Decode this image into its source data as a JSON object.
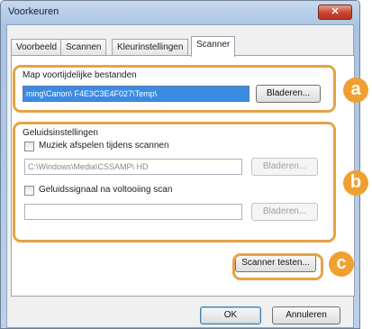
{
  "window": {
    "title": "Voorkeuren",
    "close_label": "✕"
  },
  "tabs": [
    {
      "label": "Voorbeeld"
    },
    {
      "label": "Scannen"
    },
    {
      "label": "Kleurinstellingen"
    },
    {
      "label": "Scanner"
    }
  ],
  "temp_folder": {
    "label": "Map voortijdelijke bestanden",
    "path": "ming\\Canon\\                F4E3C3E4F027\\Temp\\",
    "browse_label": "Bladeren..."
  },
  "sound": {
    "label": "Geluidsinstellingen",
    "music_checkbox_label": "Muziek afspelen tijdens scannen",
    "music_checked": false,
    "music_path": "C:\\Windows\\Media\\CSSAMP\\ HD",
    "music_browse_label": "Bladeren...",
    "complete_checkbox_label": "Geluidssignaal na voltooiing scan",
    "complete_checked": false,
    "complete_path": "",
    "complete_browse_label": "Bladeren..."
  },
  "test_button_label": "Scanner testen...",
  "footer": {
    "ok_label": "OK",
    "cancel_label": "Annuleren"
  },
  "callouts": {
    "a": "a",
    "b": "b",
    "c": "c"
  },
  "colors": {
    "highlight": "#e6a347",
    "callout": "#f0a031",
    "selection": "#3a8be2"
  }
}
